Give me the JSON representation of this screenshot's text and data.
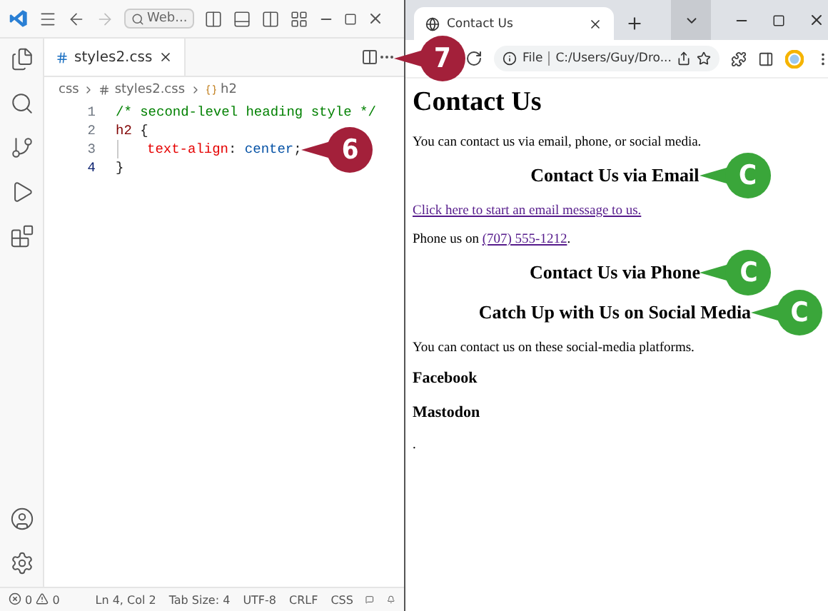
{
  "editor": {
    "search": "Web...",
    "tabs": [
      {
        "label": "styles2.css",
        "selected": true
      }
    ],
    "breadcrumbs": [
      "css",
      "styles2.css",
      "h2"
    ],
    "lines": [
      {
        "number": "1",
        "current": false,
        "indent": false,
        "tokens": [
          {
            "kind": "comment",
            "text": "/* second-level heading style */"
          }
        ]
      },
      {
        "number": "2",
        "current": false,
        "indent": false,
        "tokens": [
          {
            "kind": "selector",
            "text": "h2"
          },
          {
            "kind": "punct",
            "text": " {"
          }
        ]
      },
      {
        "number": "3",
        "current": false,
        "indent": true,
        "tokens": [
          {
            "kind": "property",
            "text": "text-align"
          },
          {
            "kind": "punct",
            "text": ": "
          },
          {
            "kind": "value",
            "text": "center"
          },
          {
            "kind": "punct",
            "text": ";"
          }
        ],
        "callout": {
          "label": "6",
          "color": "#a3203a"
        }
      },
      {
        "number": "4",
        "current": true,
        "indent": false,
        "tokens": [
          {
            "kind": "punct",
            "text": "}"
          }
        ]
      }
    ],
    "status": {
      "errors": "0",
      "warnings": "0",
      "items": [
        "Ln 4, Col 2",
        "Tab Size: 4",
        "UTF-8",
        "CRLF",
        "CSS"
      ]
    }
  },
  "browser": {
    "tab": {
      "label": "Contact Us",
      "selected": true
    },
    "reload_callout": {
      "label": "7",
      "color": "#a3203a"
    },
    "address": {
      "scheme": "File",
      "path": "C:/Users/Guy/Dro..."
    },
    "page": [
      {
        "kind": "h1",
        "text": "Contact Us"
      },
      {
        "kind": "p",
        "text": "You can contact us via email, phone, or social media."
      },
      {
        "kind": "h2",
        "text": "Contact Us via Email",
        "callout": {
          "label": "C",
          "color": "#3aa63a"
        }
      },
      {
        "kind": "link",
        "text": "Click here to start an email message to us."
      },
      {
        "kind": "phone",
        "text": "Phone us on ",
        "link": "(707) 555-1212",
        "after": "."
      },
      {
        "kind": "h2",
        "text": "Contact Us via Phone",
        "callout": {
          "label": "C",
          "color": "#3aa63a"
        }
      },
      {
        "kind": "h2",
        "text": "Catch Up with Us on Social Media",
        "callout": {
          "label": "C",
          "color": "#3aa63a"
        }
      },
      {
        "kind": "p",
        "text": "You can contact us on these social-media platforms."
      },
      {
        "kind": "h3",
        "text": "Facebook"
      },
      {
        "kind": "h3",
        "text": "Mastodon"
      },
      {
        "kind": "p",
        "text": "."
      }
    ]
  }
}
